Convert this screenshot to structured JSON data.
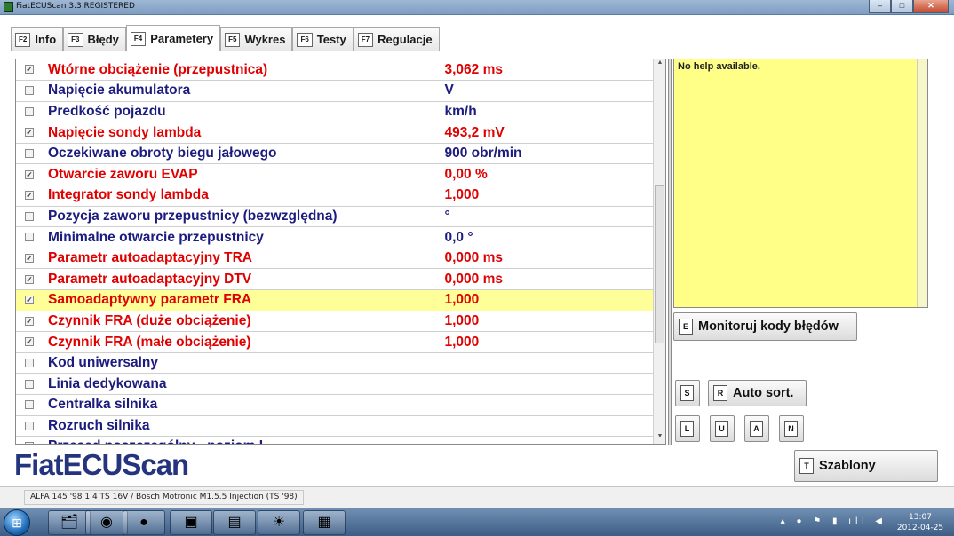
{
  "window": {
    "title": "FiatECUScan 3.3 REGISTERED",
    "minimize": "–",
    "maximize": "□",
    "close": "✕"
  },
  "tabs": [
    {
      "key": "F2",
      "label": "Info"
    },
    {
      "key": "F3",
      "label": "Błędy"
    },
    {
      "key": "F4",
      "label": "Parametery"
    },
    {
      "key": "F5",
      "label": "Wykres"
    },
    {
      "key": "F6",
      "label": "Testy"
    },
    {
      "key": "F7",
      "label": "Regulacje"
    }
  ],
  "active_tab": "Parametery",
  "parameters": [
    {
      "checked": true,
      "name": "Wtórne obciążenie (przepustnica)",
      "value": "3,062 ms"
    },
    {
      "checked": false,
      "name": "Napięcie akumulatora",
      "value": " V"
    },
    {
      "checked": false,
      "name": "Predkość pojazdu",
      "value": " km/h"
    },
    {
      "checked": true,
      "name": "Napięcie sondy lambda",
      "value": "493,2 mV"
    },
    {
      "checked": false,
      "name": "Oczekiwane obroty biegu jałowego",
      "value": "900 obr/min"
    },
    {
      "checked": true,
      "name": "Otwarcie zaworu EVAP",
      "value": "0,00 %"
    },
    {
      "checked": true,
      "name": "Integrator sondy lambda",
      "value": "1,000"
    },
    {
      "checked": false,
      "name": "Pozycja zaworu przepustnicy (bezwzględna)",
      "value": " °"
    },
    {
      "checked": false,
      "name": "Minimalne otwarcie przepustnicy",
      "value": "0,0 °"
    },
    {
      "checked": true,
      "name": "Parametr autoadaptacyjny TRA",
      "value": "0,000 ms"
    },
    {
      "checked": true,
      "name": "Parametr autoadaptacyjny DTV",
      "value": "0,000 ms"
    },
    {
      "checked": true,
      "name": "Samoadaptywny parametr FRA",
      "value": "1,000",
      "highlighted": true
    },
    {
      "checked": true,
      "name": "Czynnik FRA (duże obciążenie)",
      "value": "1,000"
    },
    {
      "checked": true,
      "name": "Czynnik FRA (małe obciążenie)",
      "value": "1,000"
    },
    {
      "checked": false,
      "name": "Kod uniwersalny",
      "value": ""
    },
    {
      "checked": false,
      "name": "Linia dedykowana",
      "value": ""
    },
    {
      "checked": false,
      "name": "Centralka silnika",
      "value": ""
    },
    {
      "checked": false,
      "name": "Rozruch silnika",
      "value": ""
    },
    {
      "checked": false,
      "name": "Przesąd poszczególny - poziom I",
      "value": ""
    }
  ],
  "help": {
    "text": "No help available."
  },
  "buttons": {
    "monitor": {
      "key": "E",
      "label": "Monitoruj kody błędów"
    },
    "s": {
      "key": "S"
    },
    "autosort": {
      "key": "R",
      "label": "Auto sort."
    },
    "l": {
      "key": "L"
    },
    "u": {
      "key": "U"
    },
    "a": {
      "key": "A"
    },
    "n": {
      "key": "N"
    },
    "templates": {
      "key": "T",
      "label": "Szablony"
    }
  },
  "logo": "FiatECUScan",
  "status": {
    "vehicle": "ALFA 145 '98 1.4 TS 16V / Bosch Motronic M1.5.5 Injection (TS '98)"
  },
  "taskbar": {
    "start": "⊞",
    "apps": [
      "explorer-icon",
      "chrome-icon",
      "firefox-icon",
      "folder-icon",
      "notepad-icon",
      "sun-icon",
      "fiatecuscan-icon"
    ],
    "time": "13:07",
    "date": "2012-04-25"
  },
  "colors": {
    "active_param": "#e00000",
    "inactive_param": "#1c1c7e",
    "highlight": "#ffff99",
    "help_bg": "#ffff88",
    "logo": "#24347e"
  }
}
